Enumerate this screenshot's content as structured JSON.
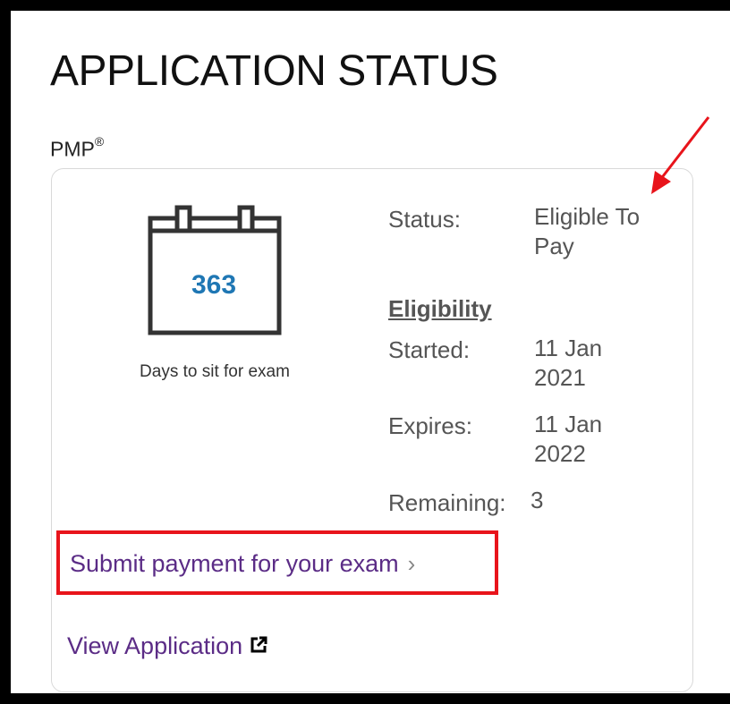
{
  "header": {
    "title": "APPLICATION STATUS",
    "product": "PMP",
    "product_mark": "®"
  },
  "calendar": {
    "days": "363",
    "caption": "Days to sit for exam"
  },
  "status": {
    "label": "Status:",
    "value_line1": "Eligible To",
    "value_line2": "Pay"
  },
  "eligibility": {
    "heading": "Eligibility",
    "started_label": "Started:",
    "started_line1": "11 Jan",
    "started_line2": "2021",
    "expires_label": "Expires:",
    "expires_line1": "11 Jan",
    "expires_line2": "2022",
    "remaining_label": "Remaining:",
    "remaining_value": "3"
  },
  "actions": {
    "submit_payment": "Submit payment for your exam",
    "view_application": "View Application"
  },
  "icons": {
    "calendar": "calendar-icon",
    "chevron": "chevron-right-icon",
    "external": "external-link-icon",
    "annotation": "red-arrow"
  },
  "colors": {
    "link": "#5b2c86",
    "days": "#1f77b4",
    "highlight": "#e8141b"
  }
}
